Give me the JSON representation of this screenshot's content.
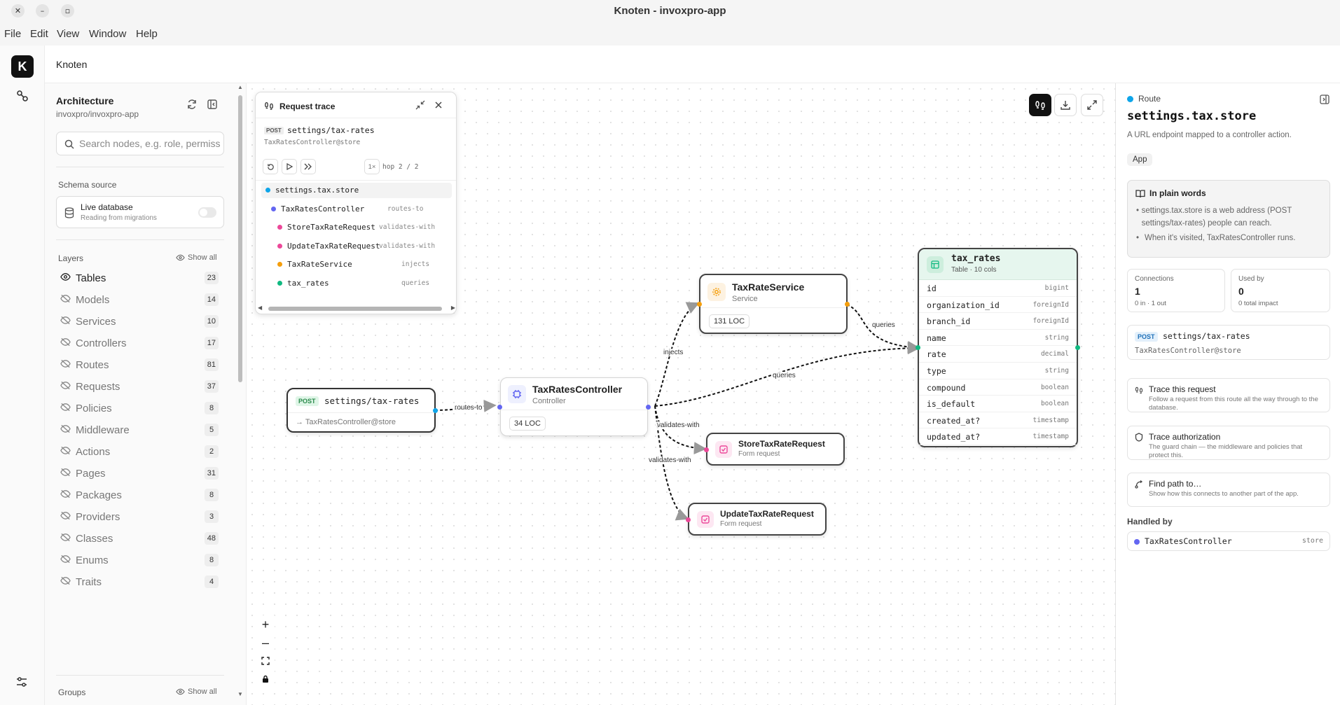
{
  "window": {
    "title": "Knoten - invoxpro-app",
    "close": "✕",
    "minimize": "–",
    "maximize": "▫"
  },
  "menu": [
    "File",
    "Edit",
    "View",
    "Window",
    "Help"
  ],
  "rail": {
    "logo": "K"
  },
  "header": {
    "app_name": "Knoten"
  },
  "sidebar": {
    "title": "Architecture",
    "subtitle": "invoxpro/invoxpro-app",
    "search_placeholder": "Search nodes, e.g. role, permiss",
    "schema_label": "Schema source",
    "schema_title": "Live database",
    "schema_sub": "Reading from migrations",
    "layers_label": "Layers",
    "show_all": "Show all",
    "layers": [
      {
        "name": "Tables",
        "count": "23",
        "visible": true
      },
      {
        "name": "Models",
        "count": "14",
        "visible": false
      },
      {
        "name": "Services",
        "count": "10",
        "visible": false
      },
      {
        "name": "Controllers",
        "count": "17",
        "visible": false
      },
      {
        "name": "Routes",
        "count": "81",
        "visible": false
      },
      {
        "name": "Requests",
        "count": "37",
        "visible": false
      },
      {
        "name": "Policies",
        "count": "8",
        "visible": false
      },
      {
        "name": "Middleware",
        "count": "5",
        "visible": false
      },
      {
        "name": "Actions",
        "count": "2",
        "visible": false
      },
      {
        "name": "Pages",
        "count": "31",
        "visible": false
      },
      {
        "name": "Packages",
        "count": "8",
        "visible": false
      },
      {
        "name": "Providers",
        "count": "3",
        "visible": false
      },
      {
        "name": "Classes",
        "count": "48",
        "visible": false
      },
      {
        "name": "Enums",
        "count": "8",
        "visible": false
      },
      {
        "name": "Traits",
        "count": "4",
        "visible": false
      }
    ],
    "groups_label": "Groups",
    "groups_show_all": "Show all"
  },
  "trace": {
    "title": "Request trace",
    "method": "POST",
    "path": "settings/tax-rates",
    "handler": "TaxRatesController@store",
    "speed": "1×",
    "hop": "hop 2 / 2",
    "steps": [
      {
        "name": "settings.tax.store",
        "rel": "",
        "color": "#0ea5e9"
      },
      {
        "name": "TaxRatesController",
        "rel": "routes-to",
        "color": "#6366f1"
      },
      {
        "name": "StoreTaxRateRequest",
        "rel": "validates-with",
        "color": "#ec4899"
      },
      {
        "name": "UpdateTaxRateRequest",
        "rel": "validates-with",
        "color": "#ec4899"
      },
      {
        "name": "TaxRateService",
        "rel": "injects",
        "color": "#f59e0b"
      },
      {
        "name": "tax_rates",
        "rel": "queries",
        "color": "#10b981"
      }
    ]
  },
  "nodes": {
    "route": {
      "method": "POST",
      "path": "settings/tax-rates",
      "handler": "→ TaxRatesController@store"
    },
    "controller": {
      "name": "TaxRatesController",
      "kind": "Controller",
      "loc": "34 LOC"
    },
    "service": {
      "name": "TaxRateService",
      "kind": "Service",
      "loc": "131 LOC"
    },
    "store_req": {
      "name": "StoreTaxRateRequest",
      "kind": "Form request"
    },
    "update_req": {
      "name": "UpdateTaxRateRequest",
      "kind": "Form request"
    },
    "table": {
      "name": "tax_rates",
      "sub": "Table · 10 cols",
      "columns": [
        {
          "name": "id",
          "type": "bigint"
        },
        {
          "name": "organization_id",
          "type": "foreignId"
        },
        {
          "name": "branch_id",
          "type": "foreignId"
        },
        {
          "name": "name",
          "type": "string"
        },
        {
          "name": "rate",
          "type": "decimal"
        },
        {
          "name": "type",
          "type": "string"
        },
        {
          "name": "compound",
          "type": "boolean"
        },
        {
          "name": "is_default",
          "type": "boolean"
        },
        {
          "name": "created_at?",
          "type": "timestamp"
        },
        {
          "name": "updated_at?",
          "type": "timestamp"
        }
      ]
    }
  },
  "edges": {
    "routes_to": "routes-to",
    "injects": "injects",
    "queries1": "queries",
    "queries2": "queries",
    "validates1": "validates-with",
    "validates2": "validates-with"
  },
  "colors": {
    "route": "#0ea5e9",
    "controller": "#6366f1",
    "service": "#f59e0b",
    "request": "#ec4899",
    "table": "#10b981"
  },
  "detail": {
    "kind": "Route",
    "name": "settings.tax.store",
    "desc": "A URL endpoint mapped to a controller action.",
    "tag": "App",
    "plain_title": "In plain words",
    "plain_items": [
      "settings.tax.store is a web address (POST settings/tax-rates) people can reach.",
      "When it's visited, TaxRatesController runs."
    ],
    "connections_label": "Connections",
    "connections": "1",
    "connections_sub": "0 in · 1 out",
    "used_label": "Used by",
    "used": "0",
    "used_sub": "0 total impact",
    "method": "POST",
    "path": "settings/tax-rates",
    "handler": "TaxRatesController@store",
    "actions": [
      {
        "title": "Trace this request",
        "desc": "Follow a request from this route all the way through to the database."
      },
      {
        "title": "Trace authorization",
        "desc": "The guard chain — the middleware and policies that protect this."
      },
      {
        "title": "Find path to…",
        "desc": "Show how this connects to another part of the app."
      }
    ],
    "handled_label": "Handled by",
    "handled_name": "TaxRatesController",
    "handled_method": "store"
  }
}
